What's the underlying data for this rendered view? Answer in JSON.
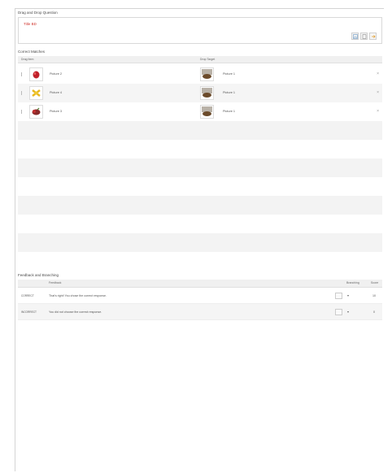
{
  "question": {
    "panel_title": "Drag and Drop Question",
    "title_link": "Title BD",
    "toolbar_icons": [
      "image-icon",
      "document-icon",
      "arrow-icon"
    ]
  },
  "matches": {
    "panel_title": "Correct Matches",
    "columns": {
      "drag_item": "Drag Item",
      "drop_target": "Drop Target"
    },
    "rows": [
      {
        "drag_label": "Picture 2",
        "drag_thumb": "red-object-icon",
        "target_label": "Picture 1",
        "target_thumb": "bowl-icon",
        "delete": "×"
      },
      {
        "drag_label": "Picture 4",
        "drag_thumb": "yellow-object-icon",
        "target_label": "Picture 1",
        "target_thumb": "bowl-icon",
        "delete": "×"
      },
      {
        "drag_label": "Picture 3",
        "drag_thumb": "fruit-icon",
        "target_label": "Picture 1",
        "target_thumb": "bowl-icon",
        "delete": "×"
      }
    ]
  },
  "feedback": {
    "panel_title": "Feedback and Branching",
    "columns": {
      "feedback": "Feedback",
      "branching": "Branching",
      "score": "Score"
    },
    "rows": [
      {
        "type": "CORRECT",
        "text": "That's right! You chose the correct response.",
        "branching": "▾",
        "score": "10"
      },
      {
        "type": "INCORRECT",
        "text": "You did not choose the correct response.",
        "branching": "▾",
        "score": "0"
      }
    ]
  },
  "colors": {
    "title_link": "#d0342c",
    "header_bg": "#f0f0f0",
    "stripe": "#f3f3f3",
    "border": "#d9d9d9"
  }
}
